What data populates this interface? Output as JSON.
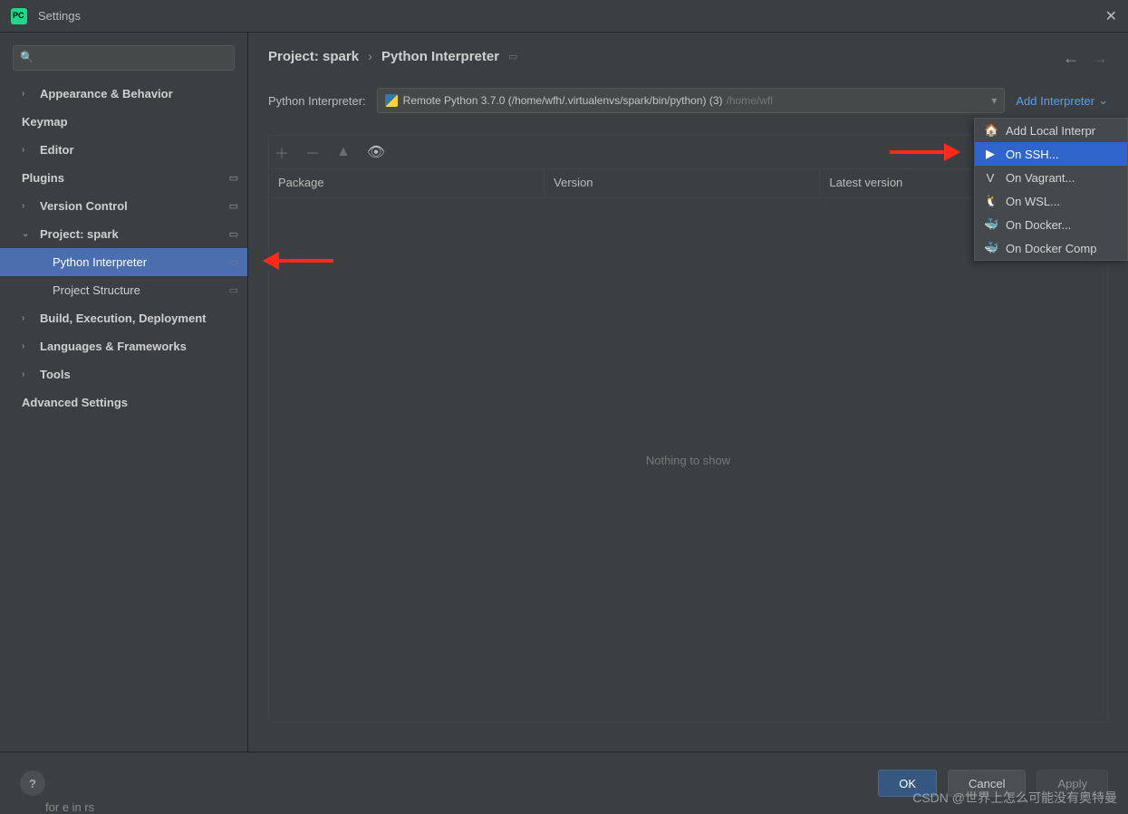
{
  "titlebar": {
    "title": "Settings"
  },
  "search": {
    "placeholder": ""
  },
  "sidebar": {
    "items": [
      {
        "label": "Appearance & Behavior",
        "bold": true,
        "chev": ">",
        "gear": false
      },
      {
        "label": "Keymap",
        "bold": true,
        "chev": "",
        "gear": false
      },
      {
        "label": "Editor",
        "bold": true,
        "chev": ">",
        "gear": false
      },
      {
        "label": "Plugins",
        "bold": true,
        "chev": "",
        "gear": true
      },
      {
        "label": "Version Control",
        "bold": true,
        "chev": ">",
        "gear": true
      },
      {
        "label": "Project: spark",
        "bold": true,
        "chev": "v",
        "gear": true
      },
      {
        "label": "Python Interpreter",
        "bold": false,
        "sub": true,
        "selected": true,
        "gear": true
      },
      {
        "label": "Project Structure",
        "bold": false,
        "sub": true,
        "gear": true
      },
      {
        "label": "Build, Execution, Deployment",
        "bold": true,
        "chev": ">",
        "gear": false
      },
      {
        "label": "Languages & Frameworks",
        "bold": true,
        "chev": ">",
        "gear": false
      },
      {
        "label": "Tools",
        "bold": true,
        "chev": ">",
        "gear": false
      },
      {
        "label": "Advanced Settings",
        "bold": true,
        "chev": "",
        "gear": false
      }
    ]
  },
  "breadcrumb": {
    "a": "Project: spark",
    "b": "Python Interpreter"
  },
  "interpreter": {
    "label": "Python Interpreter:",
    "value": "Remote Python 3.7.0 (/home/wfh/.virtualenvs/spark/bin/python) (3)",
    "extra": "/home/wfl",
    "add_label": "Add Interpreter"
  },
  "table": {
    "cols": {
      "pkg": "Package",
      "ver": "Version",
      "lat": "Latest version"
    },
    "empty": "Nothing to show"
  },
  "dropdown": {
    "items": [
      {
        "icon": "🏠",
        "label": "Add Local Interpr"
      },
      {
        "icon": "▶",
        "label": "On SSH...",
        "selected": true
      },
      {
        "icon": "V",
        "label": "On Vagrant..."
      },
      {
        "icon": "🐧",
        "label": "On WSL..."
      },
      {
        "icon": "🐳",
        "label": "On Docker..."
      },
      {
        "icon": "🐳",
        "label": "On Docker Comp"
      }
    ]
  },
  "footer": {
    "ok": "OK",
    "cancel": "Cancel",
    "apply": "Apply"
  },
  "watermark": "CSDN @世界上怎么可能没有奥特曼",
  "under": "for e in rs"
}
